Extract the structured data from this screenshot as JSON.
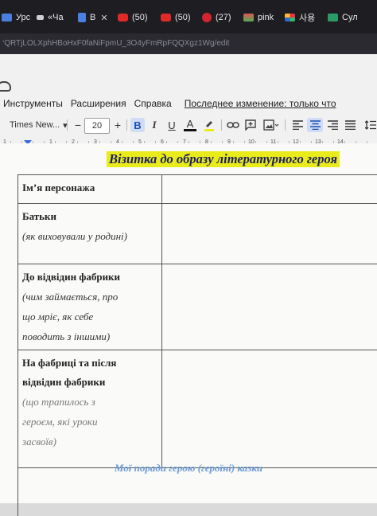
{
  "browser": {
    "tabs": [
      {
        "label": "Урс",
        "icon": "doc-icon"
      },
      {
        "label": "«Ча",
        "icon": "drive-icon"
      },
      {
        "label": "В",
        "icon": "docs-icon"
      },
      {
        "label": "(50)",
        "icon": "youtube-icon"
      },
      {
        "label": "(50)",
        "icon": "youtube-icon"
      },
      {
        "label": "(27)",
        "icon": "pinterest-icon"
      },
      {
        "label": "pink",
        "icon": "image-icon"
      },
      {
        "label": "사용",
        "icon": "grid-icon"
      },
      {
        "label": "Сул",
        "icon": "app-icon"
      }
    ],
    "close_symbol": "✕",
    "url": "‘QRTjLOLXphHBoHxF0faNiFpmU_3O4yFmRpFQQXgz1Wg/edit"
  },
  "docs": {
    "menu": [
      "Инструменты",
      "Расширения",
      "Справка"
    ],
    "last_edit": "Последнее изменение: только что",
    "toolbar": {
      "font": "Times New...",
      "font_arrow": "▾",
      "minus": "−",
      "size": "20",
      "plus": "+",
      "bold": "B",
      "italic": "I",
      "text_color": "A"
    },
    "ruler_numbers": [
      "1",
      "1",
      "2",
      "3",
      "4",
      "5",
      "6",
      "7",
      "8",
      "9",
      "10",
      "11",
      "12",
      "13",
      "14"
    ]
  },
  "document": {
    "title": "Візитка до образу літературного героя",
    "rows": [
      {
        "heading": [
          "Ім’я персонажа"
        ],
        "hint": []
      },
      {
        "heading": [
          "Батьки"
        ],
        "hint": [
          "(як виховували у родині)"
        ]
      },
      {
        "heading": [
          "До відвідин фабрики"
        ],
        "hint": [
          "(чим займається, про",
          "що мріє, як себе",
          "поводить з іншими)"
        ]
      },
      {
        "heading": [
          "На фабриці та після",
          "відвідин фабрики"
        ],
        "hint": [
          "(що трапилось з",
          "героєм, які уроки",
          "засвоїв)"
        ]
      }
    ],
    "footer": "Мої поради герою (героїні) казки"
  },
  "colors": {
    "title_highlight": "#e9ec1a",
    "title_text": "#1d1d6a",
    "footer_text": "#6b9bd6",
    "active_bold_bg": "#cfdcf3"
  }
}
